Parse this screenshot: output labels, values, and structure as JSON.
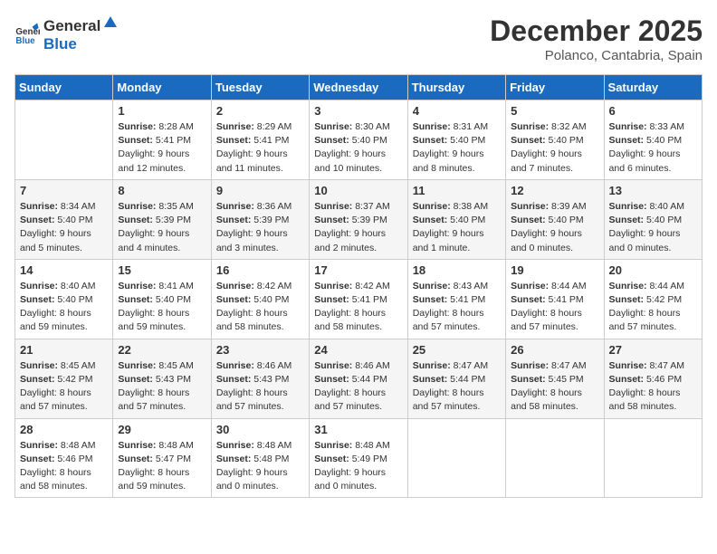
{
  "logo": {
    "text_general": "General",
    "text_blue": "Blue"
  },
  "header": {
    "title": "December 2025",
    "subtitle": "Polanco, Cantabria, Spain"
  },
  "calendar": {
    "columns": [
      "Sunday",
      "Monday",
      "Tuesday",
      "Wednesday",
      "Thursday",
      "Friday",
      "Saturday"
    ],
    "weeks": [
      [
        {
          "day": "",
          "info": ""
        },
        {
          "day": "1",
          "info": "Sunrise: 8:28 AM\nSunset: 5:41 PM\nDaylight: 9 hours\nand 12 minutes."
        },
        {
          "day": "2",
          "info": "Sunrise: 8:29 AM\nSunset: 5:41 PM\nDaylight: 9 hours\nand 11 minutes."
        },
        {
          "day": "3",
          "info": "Sunrise: 8:30 AM\nSunset: 5:40 PM\nDaylight: 9 hours\nand 10 minutes."
        },
        {
          "day": "4",
          "info": "Sunrise: 8:31 AM\nSunset: 5:40 PM\nDaylight: 9 hours\nand 8 minutes."
        },
        {
          "day": "5",
          "info": "Sunrise: 8:32 AM\nSunset: 5:40 PM\nDaylight: 9 hours\nand 7 minutes."
        },
        {
          "day": "6",
          "info": "Sunrise: 8:33 AM\nSunset: 5:40 PM\nDaylight: 9 hours\nand 6 minutes."
        }
      ],
      [
        {
          "day": "7",
          "info": "Sunrise: 8:34 AM\nSunset: 5:40 PM\nDaylight: 9 hours\nand 5 minutes."
        },
        {
          "day": "8",
          "info": "Sunrise: 8:35 AM\nSunset: 5:39 PM\nDaylight: 9 hours\nand 4 minutes."
        },
        {
          "day": "9",
          "info": "Sunrise: 8:36 AM\nSunset: 5:39 PM\nDaylight: 9 hours\nand 3 minutes."
        },
        {
          "day": "10",
          "info": "Sunrise: 8:37 AM\nSunset: 5:39 PM\nDaylight: 9 hours\nand 2 minutes."
        },
        {
          "day": "11",
          "info": "Sunrise: 8:38 AM\nSunset: 5:40 PM\nDaylight: 9 hours\nand 1 minute."
        },
        {
          "day": "12",
          "info": "Sunrise: 8:39 AM\nSunset: 5:40 PM\nDaylight: 9 hours\nand 0 minutes."
        },
        {
          "day": "13",
          "info": "Sunrise: 8:40 AM\nSunset: 5:40 PM\nDaylight: 9 hours\nand 0 minutes."
        }
      ],
      [
        {
          "day": "14",
          "info": "Sunrise: 8:40 AM\nSunset: 5:40 PM\nDaylight: 8 hours\nand 59 minutes."
        },
        {
          "day": "15",
          "info": "Sunrise: 8:41 AM\nSunset: 5:40 PM\nDaylight: 8 hours\nand 59 minutes."
        },
        {
          "day": "16",
          "info": "Sunrise: 8:42 AM\nSunset: 5:40 PM\nDaylight: 8 hours\nand 58 minutes."
        },
        {
          "day": "17",
          "info": "Sunrise: 8:42 AM\nSunset: 5:41 PM\nDaylight: 8 hours\nand 58 minutes."
        },
        {
          "day": "18",
          "info": "Sunrise: 8:43 AM\nSunset: 5:41 PM\nDaylight: 8 hours\nand 57 minutes."
        },
        {
          "day": "19",
          "info": "Sunrise: 8:44 AM\nSunset: 5:41 PM\nDaylight: 8 hours\nand 57 minutes."
        },
        {
          "day": "20",
          "info": "Sunrise: 8:44 AM\nSunset: 5:42 PM\nDaylight: 8 hours\nand 57 minutes."
        }
      ],
      [
        {
          "day": "21",
          "info": "Sunrise: 8:45 AM\nSunset: 5:42 PM\nDaylight: 8 hours\nand 57 minutes."
        },
        {
          "day": "22",
          "info": "Sunrise: 8:45 AM\nSunset: 5:43 PM\nDaylight: 8 hours\nand 57 minutes."
        },
        {
          "day": "23",
          "info": "Sunrise: 8:46 AM\nSunset: 5:43 PM\nDaylight: 8 hours\nand 57 minutes."
        },
        {
          "day": "24",
          "info": "Sunrise: 8:46 AM\nSunset: 5:44 PM\nDaylight: 8 hours\nand 57 minutes."
        },
        {
          "day": "25",
          "info": "Sunrise: 8:47 AM\nSunset: 5:44 PM\nDaylight: 8 hours\nand 57 minutes."
        },
        {
          "day": "26",
          "info": "Sunrise: 8:47 AM\nSunset: 5:45 PM\nDaylight: 8 hours\nand 58 minutes."
        },
        {
          "day": "27",
          "info": "Sunrise: 8:47 AM\nSunset: 5:46 PM\nDaylight: 8 hours\nand 58 minutes."
        }
      ],
      [
        {
          "day": "28",
          "info": "Sunrise: 8:48 AM\nSunset: 5:46 PM\nDaylight: 8 hours\nand 58 minutes."
        },
        {
          "day": "29",
          "info": "Sunrise: 8:48 AM\nSunset: 5:47 PM\nDaylight: 8 hours\nand 59 minutes."
        },
        {
          "day": "30",
          "info": "Sunrise: 8:48 AM\nSunset: 5:48 PM\nDaylight: 9 hours\nand 0 minutes."
        },
        {
          "day": "31",
          "info": "Sunrise: 8:48 AM\nSunset: 5:49 PM\nDaylight: 9 hours\nand 0 minutes."
        },
        {
          "day": "",
          "info": ""
        },
        {
          "day": "",
          "info": ""
        },
        {
          "day": "",
          "info": ""
        }
      ]
    ]
  }
}
